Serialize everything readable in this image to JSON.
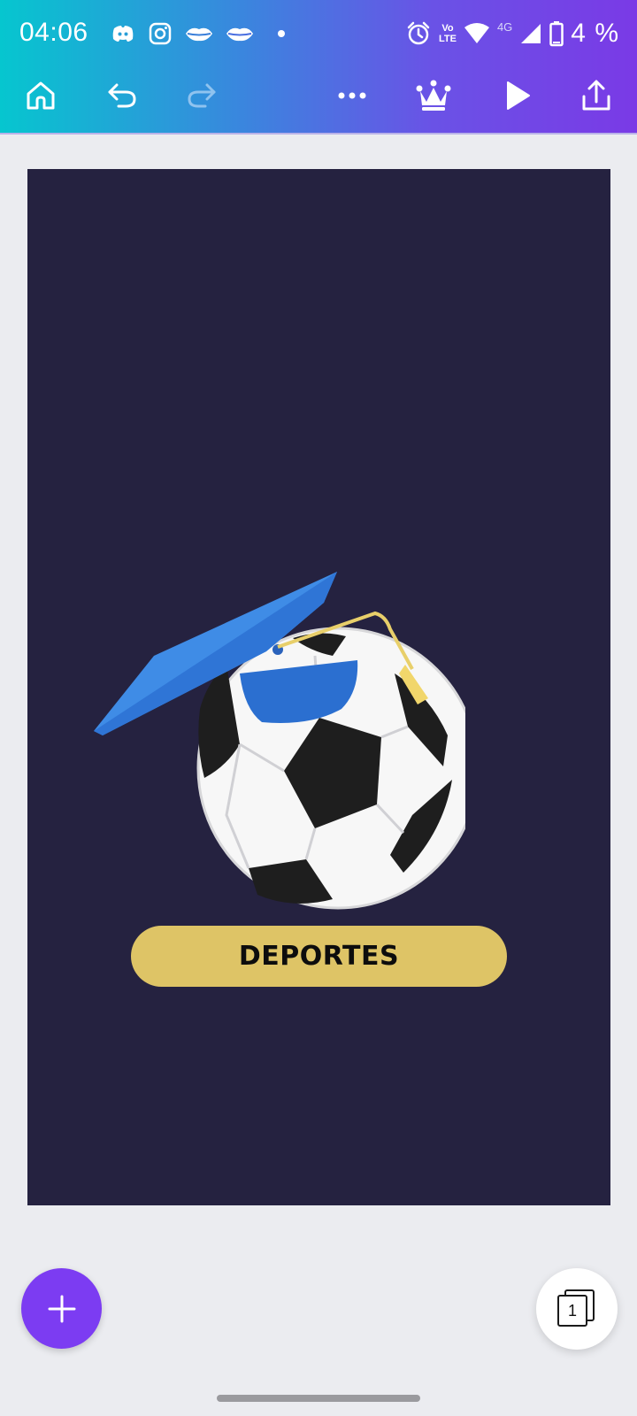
{
  "status_bar": {
    "time": "04:06",
    "network_volte_top": "Vo",
    "network_volte_bottom": "LTE",
    "network_type": "4G",
    "battery_percent": "4 %"
  },
  "toolbar": {
    "home_icon": "home-icon",
    "undo_icon": "undo-icon",
    "redo_icon": "redo-icon",
    "more_icon": "more-options-icon",
    "premium_icon": "crown-icon",
    "present_icon": "play-icon",
    "share_icon": "share-icon"
  },
  "design": {
    "background_color": "#252240",
    "label_text": "DEPORTES",
    "label_color": "#dec466"
  },
  "fab": {
    "add_icon": "plus-icon",
    "accent": "#7c3cf2"
  },
  "pages": {
    "count": "1"
  }
}
